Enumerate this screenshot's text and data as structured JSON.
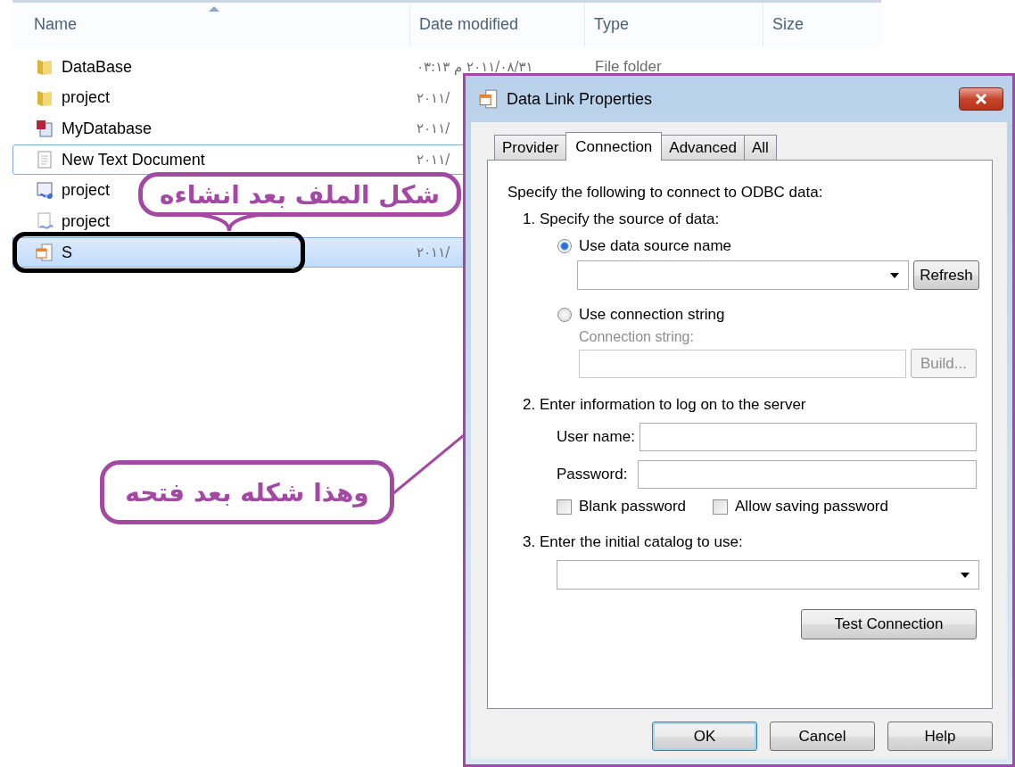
{
  "explorer": {
    "columns": [
      "Name",
      "Date modified",
      "Type",
      "Size"
    ],
    "rows": [
      {
        "name": "DataBase",
        "kind": "folder",
        "date": "٢٠١١/٠٨/٣١ م ٠٣:١٣",
        "type": "File folder",
        "selected": false,
        "focused": false
      },
      {
        "name": "project",
        "kind": "folder",
        "date": "٢٠١١/",
        "selected": false,
        "focused": false
      },
      {
        "name": "MyDatabase",
        "kind": "access",
        "date": "٢٠١١/",
        "selected": false,
        "focused": false
      },
      {
        "name": "New Text Document",
        "kind": "text",
        "date": "٢٠١١/",
        "selected": false,
        "focused": true
      },
      {
        "name": "project",
        "kind": "solution",
        "selected": false,
        "focused": false
      },
      {
        "name": "project",
        "kind": "project",
        "selected": false,
        "focused": false
      },
      {
        "name": "S",
        "kind": "udl",
        "date": "٢٠١١/",
        "selected": true,
        "focused": false
      }
    ]
  },
  "annotations": [
    {
      "text": "شكل الملف بعد انشاءه"
    },
    {
      "text": "وهذا شكله بعد فتحه"
    }
  ],
  "dialog": {
    "title": "Data Link Properties",
    "tabs": [
      {
        "label": "Provider",
        "selected": false
      },
      {
        "label": "Connection",
        "selected": true
      },
      {
        "label": "Advanced",
        "selected": false
      },
      {
        "label": "All",
        "selected": false
      }
    ],
    "intro": "Specify the following to connect to ODBC data:",
    "step1": "1. Specify the source of data:",
    "radios": [
      {
        "label": "Use data source name",
        "selected": true
      },
      {
        "label": "Use connection string",
        "selected": false
      }
    ],
    "refresh": "Refresh",
    "connection_string_label": "Connection string:",
    "build": "Build...",
    "step2": "2. Enter information to log on to the server",
    "user_name_label": "User name:",
    "password_label": "Password:",
    "checkboxes": [
      {
        "label": "Blank password",
        "checked": false
      },
      {
        "label": "Allow saving password",
        "checked": false
      }
    ],
    "step3": "3. Enter the initial catalog to use:",
    "test_connection": "Test Connection",
    "buttons": [
      {
        "label": "OK",
        "default": true
      },
      {
        "label": "Cancel",
        "default": false
      },
      {
        "label": "Help",
        "default": false
      }
    ]
  }
}
